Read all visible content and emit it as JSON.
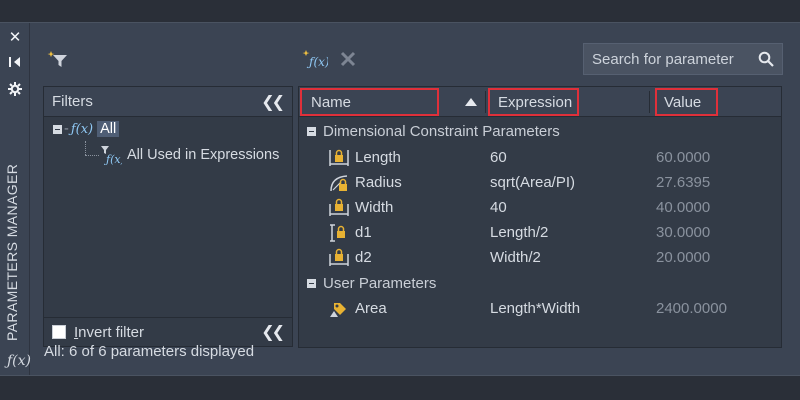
{
  "window": {
    "title": "PARAMETERS MANAGER",
    "side_icon": "ƒ(x)"
  },
  "toolbar": {
    "filter_icon": "new-filter-icon",
    "new_param_icon": "new-user-parameter-icon",
    "delete_icon": "delete-icon"
  },
  "search": {
    "placeholder": "Search for parameter"
  },
  "filters": {
    "header": "Filters",
    "tree": [
      {
        "label": "All",
        "fx": "ƒ(x)",
        "selected": true
      },
      {
        "label": "All Used in Expressions",
        "fx": "ƒ(x)",
        "selected": false
      }
    ],
    "invert_label": "Invert filter"
  },
  "grid": {
    "columns": [
      "Name",
      "Expression",
      "Value"
    ],
    "groups": [
      {
        "label": "Dimensional Constraint Parameters",
        "rows": [
          {
            "icon": "linear-lock-icon",
            "name": "Length",
            "expression": "60",
            "value": "60.0000"
          },
          {
            "icon": "radius-lock-icon",
            "name": "Radius",
            "expression": "sqrt(Area/PI)",
            "value": "27.6395"
          },
          {
            "icon": "horizontal-lock-icon",
            "name": "Width",
            "expression": "40",
            "value": "40.0000"
          },
          {
            "icon": "vertical-lock-icon",
            "name": "d1",
            "expression": "Length/2",
            "value": "30.0000"
          },
          {
            "icon": "horizontal-lock-icon",
            "name": "d2",
            "expression": "Width/2",
            "value": "20.0000"
          }
        ]
      },
      {
        "label": "User Parameters",
        "rows": [
          {
            "icon": "user-parameter-icon",
            "name": "Area",
            "expression": "Length*Width",
            "value": "2400.0000"
          }
        ]
      }
    ]
  },
  "status": "All: 6 of 6 parameters displayed",
  "colors": {
    "highlight_box": "#e0303a",
    "fx_blue": "#8fc8f4",
    "lock_gold": "#e8b233"
  }
}
